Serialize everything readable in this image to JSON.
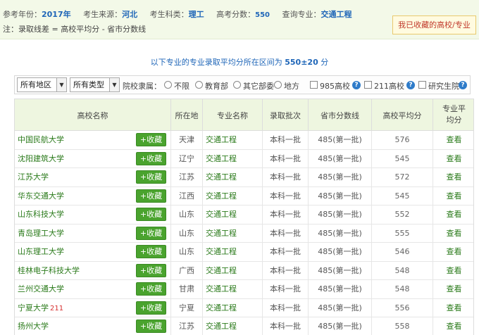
{
  "header": {
    "year_label": "参考年份：",
    "year": "2017年",
    "origin_label": "考生来源：",
    "origin": "河北",
    "category_label": "考生科类：",
    "category": "理工",
    "score_label": "高考分数：",
    "score": "550",
    "query_label": "查询专业：",
    "query_major": "交通工程",
    "note": "注：录取线差 = 高校平均分 - 省市分数线",
    "favorites_button": "我已收藏的高校/专业"
  },
  "range": {
    "text": "以下专业的专业录取平均分所在区间为",
    "value": "550±20",
    "unit": "分"
  },
  "filters": {
    "region": "所有地区",
    "type": "所有类型",
    "affiliation_label": "院校隶属：",
    "affiliation_options": [
      "不限",
      "教育部",
      "其它部委",
      "地方"
    ],
    "check_985": "985高校",
    "check_211": "211高校",
    "check_grad": "研究生院",
    "help": "?"
  },
  "table": {
    "headers": [
      "高校名称",
      "所在地",
      "专业名称",
      "录取批次",
      "省市分数线",
      "高校平均分",
      "专业平均分"
    ],
    "fav_label": "+收藏",
    "view_label": "查看",
    "rows": [
      {
        "school": "中国民航大学",
        "tag": "",
        "location": "天津",
        "major": "交通工程",
        "batch": "本科一批",
        "line": "485(第一批)",
        "avg": "576"
      },
      {
        "school": "沈阳建筑大学",
        "tag": "",
        "location": "辽宁",
        "major": "交通工程",
        "batch": "本科一批",
        "line": "485(第一批)",
        "avg": "545"
      },
      {
        "school": "江苏大学",
        "tag": "",
        "location": "江苏",
        "major": "交通工程",
        "batch": "本科一批",
        "line": "485(第一批)",
        "avg": "572"
      },
      {
        "school": "华东交通大学",
        "tag": "",
        "location": "江西",
        "major": "交通工程",
        "batch": "本科一批",
        "line": "485(第一批)",
        "avg": "545"
      },
      {
        "school": "山东科技大学",
        "tag": "",
        "location": "山东",
        "major": "交通工程",
        "batch": "本科一批",
        "line": "485(第一批)",
        "avg": "552"
      },
      {
        "school": "青岛理工大学",
        "tag": "",
        "location": "山东",
        "major": "交通工程",
        "batch": "本科一批",
        "line": "485(第一批)",
        "avg": "555"
      },
      {
        "school": "山东理工大学",
        "tag": "",
        "location": "山东",
        "major": "交通工程",
        "batch": "本科一批",
        "line": "485(第一批)",
        "avg": "546"
      },
      {
        "school": "桂林电子科技大学",
        "tag": "",
        "location": "广西",
        "major": "交通工程",
        "batch": "本科一批",
        "line": "485(第一批)",
        "avg": "548"
      },
      {
        "school": "兰州交通大学",
        "tag": "",
        "location": "甘肃",
        "major": "交通工程",
        "batch": "本科一批",
        "line": "485(第一批)",
        "avg": "548"
      },
      {
        "school": "宁夏大学",
        "tag": "211",
        "location": "宁夏",
        "major": "交通工程",
        "batch": "本科一批",
        "line": "485(第一批)",
        "avg": "556"
      },
      {
        "school": "扬州大学",
        "tag": "",
        "location": "江苏",
        "major": "交通工程",
        "batch": "本科一批",
        "line": "485(第一批)",
        "avg": "558"
      }
    ]
  }
}
